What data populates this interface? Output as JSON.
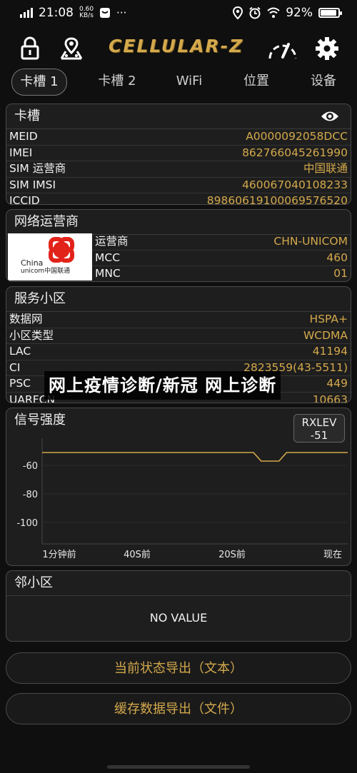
{
  "status_bar": {
    "time": "21:08",
    "speed_value": "0.60",
    "speed_unit": "KB/s",
    "extra": "···",
    "battery": "92%",
    "battery_level": 0.92
  },
  "app": {
    "title": "CELLULAR-Z",
    "accent": "#d4a94c"
  },
  "tabs": [
    "卡槽 1",
    "卡槽 2",
    "WiFi",
    "位置",
    "设备"
  ],
  "sim_card": {
    "title": "卡槽",
    "rows": [
      {
        "k": "MEID",
        "v": "A0000092058DCC"
      },
      {
        "k": "IMEI",
        "v": "862766045261990"
      },
      {
        "k": "SIM 运营商",
        "v": "中国联通"
      },
      {
        "k": "SIM IMSI",
        "v": "460067040108233"
      },
      {
        "k": "ICCID",
        "v": "89860619100069576520"
      }
    ]
  },
  "network": {
    "title": "网络运营商",
    "logo_text_top": "China",
    "logo_text_bottom": "unicom中国联通",
    "rows": [
      {
        "k": "运营商",
        "v": "CHN-UNICOM"
      },
      {
        "k": "MCC",
        "v": "460"
      },
      {
        "k": "MNC",
        "v": "01"
      }
    ]
  },
  "cell": {
    "title": "服务小区",
    "rows": [
      {
        "k": "数据网",
        "v": "HSPA+"
      },
      {
        "k": "小区类型",
        "v": "WCDMA"
      },
      {
        "k": "LAC",
        "v": "41194"
      },
      {
        "k": "CI",
        "v": "2823559(43-5511)"
      },
      {
        "k": "PSC",
        "v": "449"
      },
      {
        "k": "UARFCN",
        "v": "10663"
      }
    ]
  },
  "signal": {
    "title": "信号强度",
    "badge_label": "RXLEV",
    "badge_value": "-51"
  },
  "chart_data": {
    "type": "line",
    "title": "信号强度",
    "yticks": [
      -60,
      -80,
      -100
    ],
    "ylim": [
      -115,
      -45
    ],
    "xticks": [
      "1分钟前",
      "40S前",
      "20S前",
      "现在"
    ],
    "xlim": [
      0,
      60
    ],
    "series": [
      {
        "color": "#d4a94c",
        "x": [
          0,
          41.5,
          43,
          46.5,
          48,
          60
        ],
        "y": [
          -51,
          -51,
          -57,
          -57,
          -51,
          -51
        ]
      }
    ]
  },
  "neighbor": {
    "title": "邻小区",
    "empty": "NO VALUE"
  },
  "buttons": {
    "export_text": "当前状态导出（文本）",
    "export_file": "缓存数据导出（文件）"
  },
  "overlay": {
    "text": "网上疫情诊断/新冠 网上诊断"
  }
}
